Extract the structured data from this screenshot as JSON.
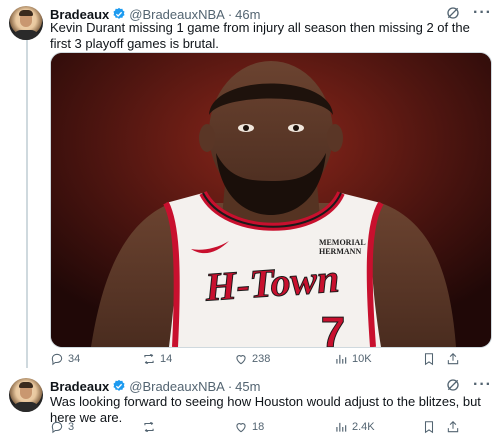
{
  "tweets": [
    {
      "author": "Bradeaux",
      "handle": "@BradeauxNBA",
      "separator": "·",
      "time": "46m",
      "text": "Kevin Durant missing 1 game from injury all season then missing 2 of the first 3 playoff games is brutal.",
      "jersey": {
        "sponsor_line1": "MEMORIAL",
        "sponsor_line2": "HERMANN",
        "wordmark": "H-Town",
        "number": "7"
      },
      "stats": {
        "replies": "34",
        "retweets": "14",
        "likes": "238",
        "views": "10K"
      }
    },
    {
      "author": "Bradeaux",
      "handle": "@BradeauxNBA",
      "separator": "·",
      "time": "45m",
      "text": "Was looking forward to seeing how Houston would adjust to the blitzes, but here we are.",
      "stats": {
        "replies": "3",
        "retweets": "",
        "likes": "18",
        "views": "2.4K"
      }
    }
  ],
  "colors": {
    "verified": "#1d9bf0",
    "text": "#0f1419",
    "muted": "#536471",
    "jersey_red": "#c8102e"
  },
  "icons": [
    "verified-badge-icon",
    "grok-icon",
    "more-icon",
    "reply-icon",
    "retweet-icon",
    "like-icon",
    "views-icon",
    "bookmark-icon",
    "share-icon"
  ]
}
